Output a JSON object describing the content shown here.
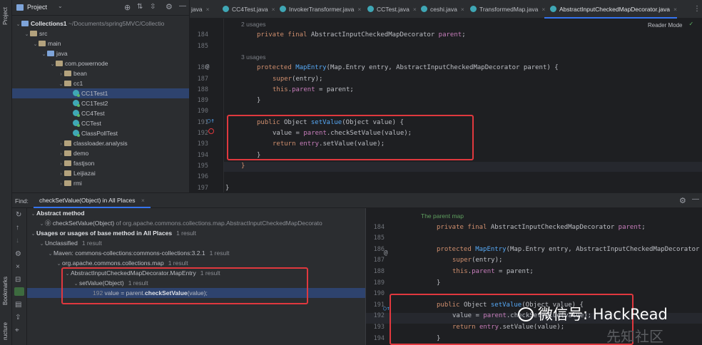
{
  "toolstrip": {
    "project_label": "Project",
    "bookmarks_label": "Bookmarks",
    "structure_label": "ructure"
  },
  "project_panel": {
    "title": "Project",
    "tree": [
      {
        "label": "Collections1",
        "suffix": "~/Documents/spring5MVC/Collectio",
        "indent": 0,
        "type": "folder-blue",
        "open": true,
        "bold": true
      },
      {
        "label": "src",
        "indent": 1,
        "type": "folder",
        "open": true
      },
      {
        "label": "main",
        "indent": 2,
        "type": "folder",
        "open": true
      },
      {
        "label": "java",
        "indent": 3,
        "type": "folder-blue",
        "open": true
      },
      {
        "label": "com.powernode",
        "indent": 4,
        "type": "folder",
        "open": true
      },
      {
        "label": "bean",
        "indent": 5,
        "type": "folder",
        "open": false
      },
      {
        "label": "cc1",
        "indent": 5,
        "type": "folder",
        "open": true
      },
      {
        "label": "CC1Test1",
        "indent": 6,
        "type": "class",
        "selected": true
      },
      {
        "label": "CC1Test2",
        "indent": 6,
        "type": "class"
      },
      {
        "label": "CC4Test",
        "indent": 6,
        "type": "class"
      },
      {
        "label": "CCTest",
        "indent": 6,
        "type": "class"
      },
      {
        "label": "ClassPollTest",
        "indent": 6,
        "type": "class"
      },
      {
        "label": "classloader.analysis",
        "indent": 5,
        "type": "folder",
        "open": false
      },
      {
        "label": "demo",
        "indent": 5,
        "type": "folder",
        "open": false
      },
      {
        "label": "fastjson",
        "indent": 5,
        "type": "folder",
        "open": false
      },
      {
        "label": "Leijiazai",
        "indent": 5,
        "type": "folder",
        "open": false
      },
      {
        "label": "rmi",
        "indent": 5,
        "type": "folder",
        "open": false
      }
    ]
  },
  "tabs": [
    {
      "label": "java",
      "icon": false
    },
    {
      "label": "CC4Test.java"
    },
    {
      "label": "InvokerTransformer.java"
    },
    {
      "label": "CCTest.java"
    },
    {
      "label": "ceshi.java"
    },
    {
      "label": "TransformedMap.java"
    },
    {
      "label": "AbstractInputCheckedMapDecorator.java",
      "active": true
    }
  ],
  "editor_top": {
    "reader_mode": "Reader Mode",
    "lines": [
      {
        "num": "",
        "hint": "2 usages"
      },
      {
        "num": "184",
        "tokens": [
          [
            "kw",
            "private final "
          ],
          [
            "",
            "AbstractInputCheckedMapDecorator "
          ],
          [
            "fld",
            "parent"
          ],
          [
            "",
            ";"
          ]
        ],
        "indent": 1
      },
      {
        "num": "185"
      },
      {
        "num": "",
        "hint": "3 usages"
      },
      {
        "num": "186",
        "tokens": [
          [
            "kw",
            "protected "
          ],
          [
            "fn",
            "MapEntry"
          ],
          [
            "",
            "(Map.Entry entry, AbstractInputCheckedMapDecorator parent) {"
          ]
        ],
        "indent": 1
      },
      {
        "num": "187",
        "tokens": [
          [
            "kw",
            "super"
          ],
          [
            "",
            "(entry);"
          ]
        ],
        "indent": 2
      },
      {
        "num": "188",
        "tokens": [
          [
            "kw",
            "this"
          ],
          [
            "",
            "."
          ],
          [
            "fld",
            "parent"
          ],
          [
            "",
            " = parent;"
          ]
        ],
        "indent": 2
      },
      {
        "num": "189",
        "tokens": [
          [
            "",
            "}"
          ]
        ],
        "indent": 1
      },
      {
        "num": "190"
      },
      {
        "num": "191",
        "tokens": [
          [
            "kw",
            "public "
          ],
          [
            "",
            "Object "
          ],
          [
            "fn",
            "setValue"
          ],
          [
            "",
            "(Object value) {"
          ]
        ],
        "indent": 1
      },
      {
        "num": "192",
        "tokens": [
          [
            "",
            "value = "
          ],
          [
            "fld",
            "parent"
          ],
          [
            "",
            ".checkSetValue(value);"
          ]
        ],
        "indent": 2
      },
      {
        "num": "193",
        "tokens": [
          [
            "kw",
            "return "
          ],
          [
            "fld",
            "entry"
          ],
          [
            "",
            ".setValue(value);"
          ]
        ],
        "indent": 2
      },
      {
        "num": "194",
        "tokens": [
          [
            "",
            "}"
          ]
        ],
        "indent": 1
      },
      {
        "num": "195",
        "tokens": [
          [
            "kw",
            "}"
          ]
        ],
        "indent": 0
      },
      {
        "num": "196"
      },
      {
        "num": "197",
        "tokens": [
          [
            "",
            "}"
          ]
        ],
        "indent": -1
      }
    ]
  },
  "find": {
    "label": "Find:",
    "tab_label": "checkSetValue(Object) in All Places",
    "results": [
      {
        "indent": 0,
        "bold": "Abstract method",
        "text": ""
      },
      {
        "indent": 1,
        "text": "checkSetValue(Object)",
        "suffix": "of org.apache.commons.collections.map.AbstractInputCheckedMapDecorato"
      },
      {
        "indent": 0,
        "bold": "Usages or usages of base method in All Places",
        "count": "1 result"
      },
      {
        "indent": 1,
        "text": "Unclassified",
        "count": "1 result"
      },
      {
        "indent": 2,
        "text": "Maven: commons-collections:commons-collections:3.2.1",
        "count": "1 result"
      },
      {
        "indent": 3,
        "text": "org.apache.commons.collections.map",
        "count": "1 result"
      },
      {
        "indent": 4,
        "text": "AbstractInputCheckedMapDecorator.MapEntry",
        "count": "1 result"
      },
      {
        "indent": 5,
        "text": "setValue(Object)",
        "count": "1 result"
      },
      {
        "indent": 6,
        "num": "192",
        "pre": "value = parent.",
        "match": "checkSetValue",
        "post": "(value);",
        "selected": true
      }
    ]
  },
  "preview": {
    "lines": [
      {
        "num": "",
        "doc": "The parent map"
      },
      {
        "num": "184",
        "tokens": [
          [
            "kw",
            "private final "
          ],
          [
            "",
            "AbstractInputCheckedMapDecorator "
          ],
          [
            "fld",
            "parent"
          ],
          [
            "",
            ";"
          ]
        ],
        "indent": 1
      },
      {
        "num": "185"
      },
      {
        "num": "186",
        "tokens": [
          [
            "kw",
            "protected "
          ],
          [
            "fn",
            "MapEntry"
          ],
          [
            "",
            "(Map.Entry entry, AbstractInputCheckedMapDecorator p"
          ]
        ],
        "indent": 1
      },
      {
        "num": "187",
        "tokens": [
          [
            "kw",
            "super"
          ],
          [
            "",
            "(entry);"
          ]
        ],
        "indent": 2
      },
      {
        "num": "188",
        "tokens": [
          [
            "kw",
            "this"
          ],
          [
            "",
            "."
          ],
          [
            "fld",
            "parent"
          ],
          [
            "",
            " = parent;"
          ]
        ],
        "indent": 2
      },
      {
        "num": "189",
        "tokens": [
          [
            "",
            "}"
          ]
        ],
        "indent": 1
      },
      {
        "num": "190"
      },
      {
        "num": "191",
        "tokens": [
          [
            "kw",
            "public "
          ],
          [
            "",
            "Object "
          ],
          [
            "fn",
            "setValue"
          ],
          [
            "",
            "(Object value) {"
          ]
        ],
        "indent": 1
      },
      {
        "num": "192",
        "tokens": [
          [
            "",
            "value = "
          ],
          [
            "fld",
            "parent"
          ],
          [
            "",
            ".checkSetValue(value);"
          ]
        ],
        "indent": 2
      },
      {
        "num": "193",
        "tokens": [
          [
            "kw",
            "return "
          ],
          [
            "fld",
            "entry"
          ],
          [
            "",
            ".setValue(value);"
          ]
        ],
        "indent": 2
      },
      {
        "num": "194",
        "tokens": [
          [
            "",
            "}"
          ]
        ],
        "indent": 1
      }
    ]
  },
  "watermark": {
    "text": "微信号: HackRead",
    "site": "先知社区"
  },
  "colors": {
    "highlight_box": "#e0383e",
    "selection": "#2e436e",
    "accent": "#3574f0"
  }
}
